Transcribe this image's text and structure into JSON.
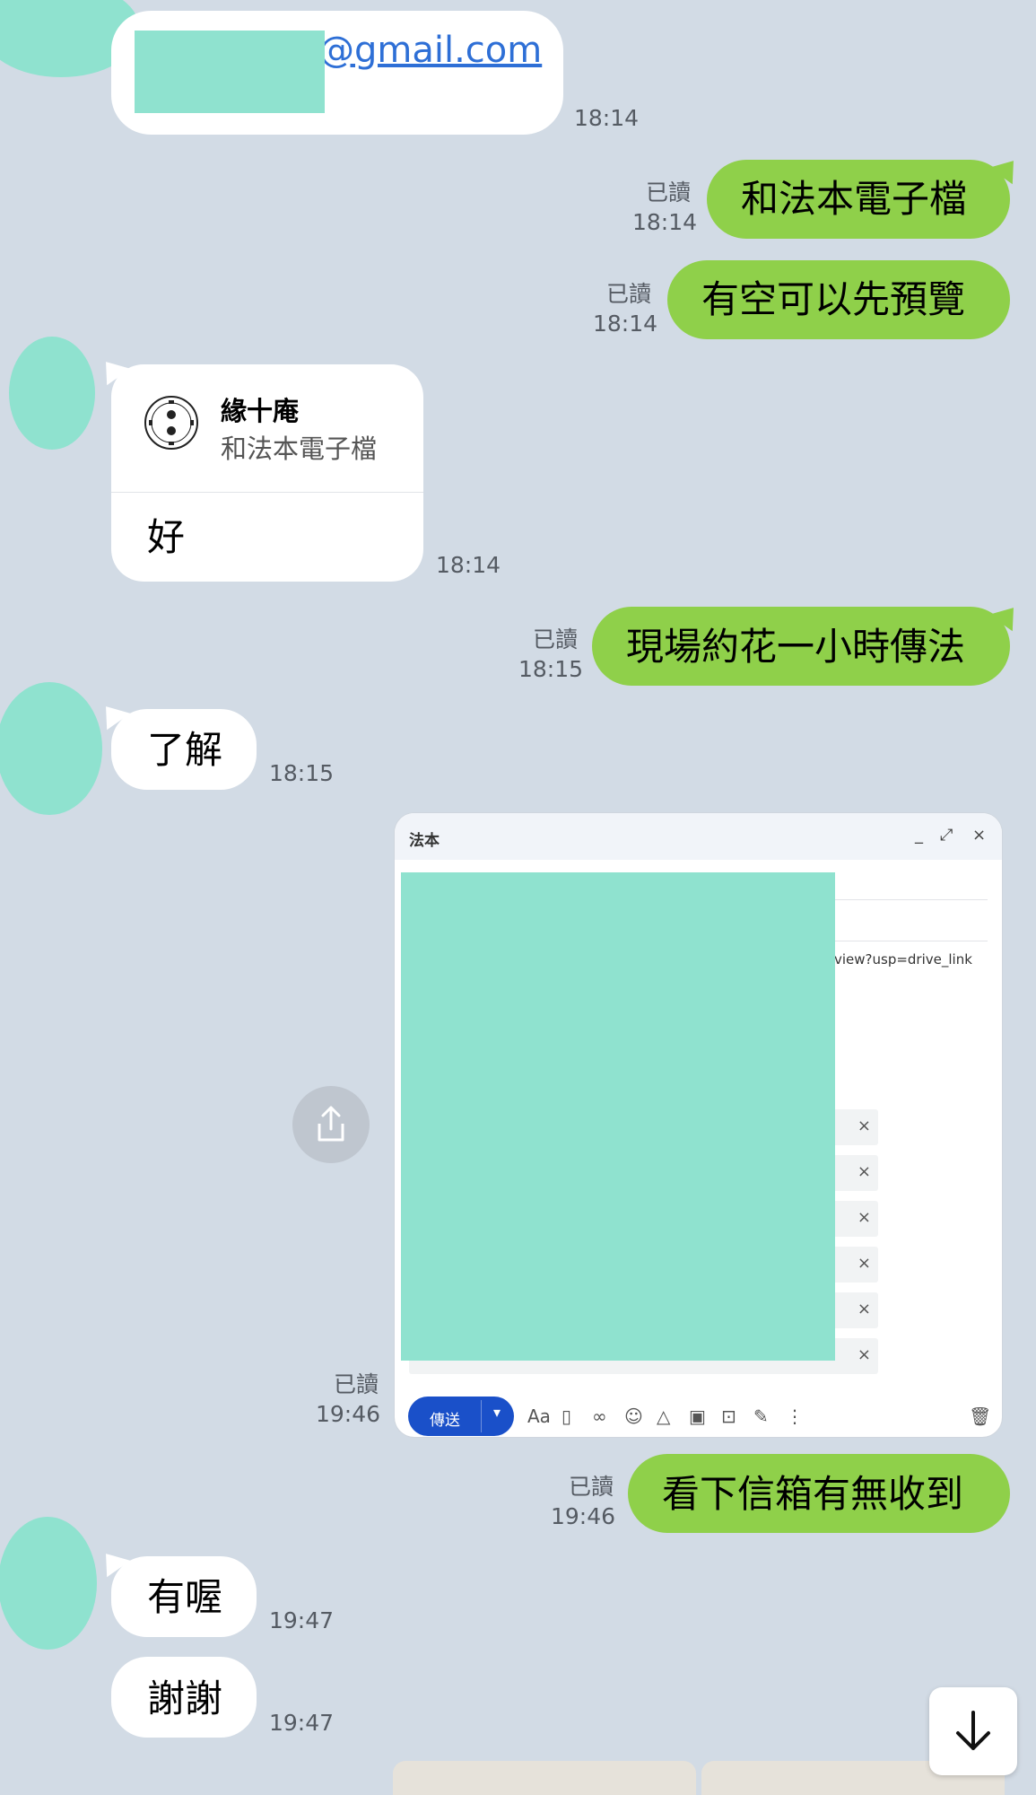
{
  "messages": {
    "m1": {
      "email": "@gmail.com",
      "time": "18:14"
    },
    "m2": {
      "text": "和法本電子檔",
      "read": "已讀",
      "time": "18:14"
    },
    "m3": {
      "text": "有空可以先預覽",
      "read": "已讀",
      "time": "18:14"
    },
    "m4": {
      "reply_sender": "緣十庵",
      "reply_quote": "和法本電子檔",
      "text": "好",
      "time": "18:14"
    },
    "m5": {
      "text": "現場約花一小時傳法",
      "read": "已讀",
      "time": "18:15"
    },
    "m6": {
      "text": "了解",
      "time": "18:15"
    },
    "m7": {
      "read": "已讀",
      "time": "19:46",
      "gmail": {
        "title": "法本",
        "link_text": "view?usp=drive_link",
        "send_label": "傳送",
        "format_label": "Aa",
        "attachment_count": 6
      }
    },
    "m8": {
      "text": "看下信箱有無收到",
      "read": "已讀",
      "time": "19:46"
    },
    "m9": {
      "text": "有喔",
      "time": "19:47"
    },
    "m10": {
      "text": "謝謝",
      "time": "19:47"
    }
  },
  "icons": {
    "share": "share-icon",
    "scroll_down": "arrow-down-icon",
    "logo": "temple-seal-logo"
  },
  "colors": {
    "background": "#d2dbe5",
    "outgoing_bubble": "#8fd04a",
    "incoming_bubble": "#ffffff",
    "redaction": "#8fe2cf",
    "send_button": "#1a50c9"
  }
}
